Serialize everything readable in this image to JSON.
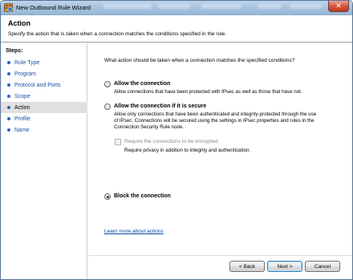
{
  "window": {
    "title": "New Outbound Rule Wizard",
    "close_glyph": "✕"
  },
  "header": {
    "title": "Action",
    "description": "Specify the action that is taken when a connection matches the conditions specified in the rule."
  },
  "steps": {
    "label": "Steps:",
    "items": [
      {
        "label": "Rule Type",
        "active": false
      },
      {
        "label": "Program",
        "active": false
      },
      {
        "label": "Protocol and Ports",
        "active": false
      },
      {
        "label": "Scope",
        "active": false
      },
      {
        "label": "Action",
        "active": true
      },
      {
        "label": "Profile",
        "active": false
      },
      {
        "label": "Name",
        "active": false
      }
    ]
  },
  "main": {
    "question": "What action should be taken when a connection matches the specified conditions?",
    "options": {
      "allow": {
        "label": "Allow the connection",
        "desc": "Allow connections that have been protected with IPsec as well as those that have not.",
        "checked": false
      },
      "allow_secure": {
        "label": "Allow the connection if it is secure",
        "desc1": "Allow only connections that have been authenticated and integrity-protected through the use",
        "desc2": "of IPsec.  Connections will be secured using the settings in IPsec properties and rules in the",
        "desc3": "Connection Security Rule node.",
        "checked": false
      },
      "require_encrypt": {
        "label": "Require the connections to be encrypted",
        "desc": "Require privacy in addition to integrity and authentication.",
        "checked": false,
        "enabled": false
      },
      "block": {
        "label": "Block the connection",
        "checked": true
      }
    },
    "learn_more": "Learn more about actions"
  },
  "footer": {
    "back": "< Back",
    "next": "Next >",
    "cancel": "Cancel"
  },
  "colors": {
    "link": "#0645ad",
    "step_link": "#1c4fa8",
    "active_step_bg": "#e0e0e0"
  }
}
